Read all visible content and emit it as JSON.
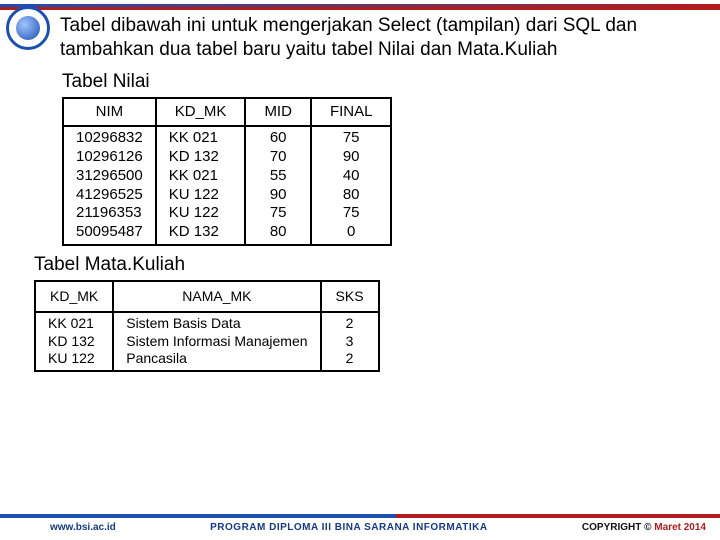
{
  "intro": "Tabel dibawah ini untuk mengerjakan Select (tampilan) dari SQL dan tambahkan dua tabel baru yaitu tabel Nilai dan Mata.Kuliah",
  "nilai": {
    "title": "Tabel Nilai",
    "headers": {
      "nim": "NIM",
      "kd_mk": "KD_MK",
      "mid": "MID",
      "final": "FINAL"
    },
    "nim": [
      "10296832",
      "10296126",
      "31296500",
      "41296525",
      "21196353",
      "50095487"
    ],
    "kd_mk": [
      "KK 021",
      "KD 132",
      "KK 021",
      "KU 122",
      "KU 122",
      "KD 132"
    ],
    "mid": [
      "60",
      "70",
      "55",
      "90",
      "75",
      "80"
    ],
    "final": [
      "75",
      "90",
      "40",
      "80",
      "75",
      "0"
    ]
  },
  "mk": {
    "title": "Tabel Mata.Kuliah",
    "headers": {
      "kd_mk": "KD_MK",
      "nama_mk": "NAMA_MK",
      "sks": "SKS"
    },
    "kd_mk": [
      "KK 021",
      "KD 132",
      "KU 122"
    ],
    "nama_mk": [
      "Sistem Basis Data",
      "Sistem Informasi Manajemen",
      "Pancasila"
    ],
    "sks": [
      "2",
      "3",
      "2"
    ]
  },
  "footer": {
    "url": "www.bsi.ac.id",
    "program": "PROGRAM DIPLOMA III BINA SARANA INFORMATIKA",
    "copyright": "COPYRIGHT ©",
    "date": "Maret 2014"
  }
}
